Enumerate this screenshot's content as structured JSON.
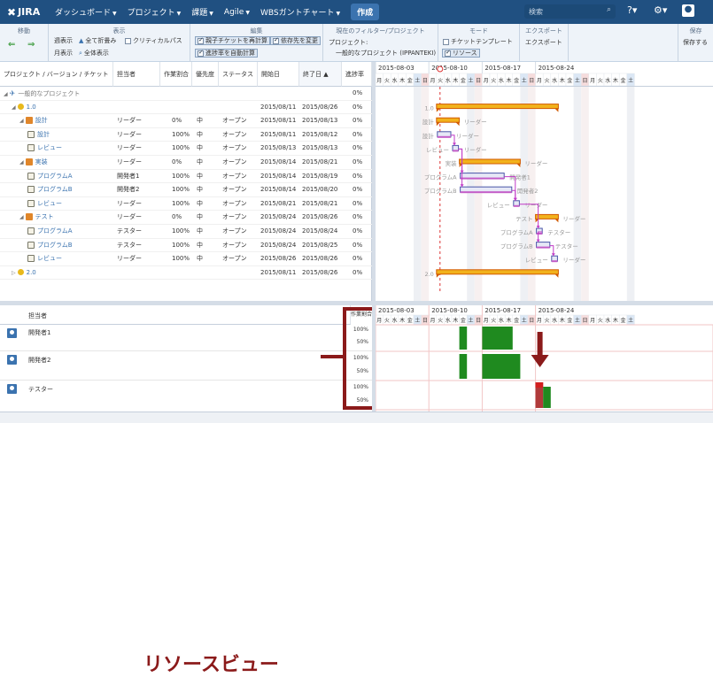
{
  "nav": {
    "logo": "JIRA",
    "items": [
      "ダッシュボード",
      "プロジェクト",
      "課題",
      "Agile",
      "WBSガントチャート"
    ],
    "create": "作成",
    "search_placeholder": "検索"
  },
  "toolbar": {
    "move": {
      "title": "移動"
    },
    "display": {
      "title": "表示",
      "weekly": "週表示",
      "collapse_all": "全て折畳み",
      "critical_path": "クリティカルパス",
      "monthly": "月表示",
      "show_all": "全体表示"
    },
    "edit": {
      "title": "編集",
      "recalc_parent": "親子チケットを再計算",
      "change_dep": "依存先を変更",
      "auto_progress": "進捗率を自動計算"
    },
    "filter": {
      "title": "現在のフィルター/プロジェクト",
      "project_label": "プロジェクト:",
      "project_value": "一般的なプロジェクト (IPPANTEKI)"
    },
    "mode": {
      "title": "モード",
      "ticket_template": "チケットテンプレート",
      "resource": "リソース"
    },
    "export": {
      "title": "エクスポート",
      "label": "エクスポート"
    },
    "save": {
      "title": "保存",
      "label": "保存する"
    }
  },
  "table": {
    "headers": [
      "プロジェクト / バージョン / チケット",
      "担当者",
      "作業割合",
      "優先度",
      "ステータス",
      "開始日",
      "終了日 ▲",
      "進捗率"
    ],
    "rows": [
      {
        "level": 0,
        "type": "proj",
        "name": "一般的なプロジェクト",
        "assignee": "",
        "ratio": "",
        "priority": "",
        "status": "",
        "start": "",
        "end": "",
        "progress": "0%"
      },
      {
        "level": 1,
        "type": "ver",
        "name": "1.0",
        "assignee": "",
        "ratio": "",
        "priority": "",
        "status": "",
        "start": "2015/08/11",
        "end": "2015/08/26",
        "progress": "0%"
      },
      {
        "level": 2,
        "type": "sum",
        "name": "設計",
        "assignee": "リーダー",
        "ratio": "0%",
        "priority": "中",
        "status": "オープン",
        "start": "2015/08/11",
        "end": "2015/08/13",
        "progress": "0%"
      },
      {
        "level": 3,
        "type": "task",
        "name": "設計",
        "assignee": "リーダー",
        "ratio": "100%",
        "priority": "中",
        "status": "オープン",
        "start": "2015/08/11",
        "end": "2015/08/12",
        "progress": "0%"
      },
      {
        "level": 3,
        "type": "task",
        "name": "レビュー",
        "assignee": "リーダー",
        "ratio": "100%",
        "priority": "中",
        "status": "オープン",
        "start": "2015/08/13",
        "end": "2015/08/13",
        "progress": "0%"
      },
      {
        "level": 2,
        "type": "sum",
        "name": "実装",
        "assignee": "リーダー",
        "ratio": "0%",
        "priority": "中",
        "status": "オープン",
        "start": "2015/08/14",
        "end": "2015/08/21",
        "progress": "0%"
      },
      {
        "level": 3,
        "type": "task",
        "name": "プログラムA",
        "assignee": "開発者1",
        "ratio": "100%",
        "priority": "中",
        "status": "オープン",
        "start": "2015/08/14",
        "end": "2015/08/19",
        "progress": "0%"
      },
      {
        "level": 3,
        "type": "task",
        "name": "プログラムB",
        "assignee": "開発者2",
        "ratio": "100%",
        "priority": "中",
        "status": "オープン",
        "start": "2015/08/14",
        "end": "2015/08/20",
        "progress": "0%"
      },
      {
        "level": 3,
        "type": "task",
        "name": "レビュー",
        "assignee": "リーダー",
        "ratio": "100%",
        "priority": "中",
        "status": "オープン",
        "start": "2015/08/21",
        "end": "2015/08/21",
        "progress": "0%"
      },
      {
        "level": 2,
        "type": "sum",
        "name": "テスト",
        "assignee": "リーダー",
        "ratio": "0%",
        "priority": "中",
        "status": "オープン",
        "start": "2015/08/24",
        "end": "2015/08/26",
        "progress": "0%"
      },
      {
        "level": 3,
        "type": "task",
        "name": "プログラムA",
        "assignee": "テスター",
        "ratio": "100%",
        "priority": "中",
        "status": "オープン",
        "start": "2015/08/24",
        "end": "2015/08/24",
        "progress": "0%"
      },
      {
        "level": 3,
        "type": "task",
        "name": "プログラムB",
        "assignee": "テスター",
        "ratio": "100%",
        "priority": "中",
        "status": "オープン",
        "start": "2015/08/24",
        "end": "2015/08/25",
        "progress": "0%"
      },
      {
        "level": 3,
        "type": "task",
        "name": "レビュー",
        "assignee": "リーダー",
        "ratio": "100%",
        "priority": "中",
        "status": "オープン",
        "start": "2015/08/26",
        "end": "2015/08/26",
        "progress": "0%"
      },
      {
        "level": 1,
        "type": "ver",
        "name": "2.0",
        "assignee": "",
        "ratio": "",
        "priority": "",
        "status": "",
        "start": "2015/08/11",
        "end": "2015/08/26",
        "progress": "0%"
      }
    ]
  },
  "gantt": {
    "weeks": [
      "2015-08-03",
      "2015-08-10",
      "2015-08-17",
      "2015-08-24"
    ],
    "days": [
      "月",
      "火",
      "水",
      "木",
      "金",
      "土",
      "日",
      "月",
      "火",
      "水",
      "木",
      "金",
      "土",
      "日",
      "月",
      "火",
      "水",
      "木",
      "金",
      "土",
      "日",
      "月",
      "火",
      "水",
      "木",
      "金",
      "土",
      "日",
      "月",
      "火",
      "水",
      "木",
      "金",
      "土"
    ],
    "bar_labels": [
      "1.0",
      "設計",
      "設計",
      "レビュー",
      "実装",
      "プログラムA",
      "プログラムB",
      "レビュー",
      "テスト",
      "プログラムA",
      "プログラムB",
      "レビュー",
      "2.0"
    ],
    "assignee_labels": [
      "リーダー",
      "リーダー",
      "リーダー",
      "リーダー",
      "開発者1",
      "開発者2",
      "リーダー",
      "リーダー",
      "テスター",
      "テスター",
      "リーダー"
    ]
  },
  "resource": {
    "header_assignee": "担当者",
    "header_ratio": "作業割合",
    "people": [
      {
        "name": "開発者1",
        "pct_top": "100%",
        "pct_bottom": "50%"
      },
      {
        "name": "開発者2",
        "pct_top": "100%",
        "pct_bottom": "50%"
      },
      {
        "name": "テスター",
        "pct_top": "100%",
        "pct_bottom": "50%"
      }
    ],
    "weeks": [
      "2015-08-03",
      "2015-08-10",
      "2015-08-17",
      "2015-08-24"
    ],
    "callout": "リソースビュー",
    "colors": {
      "green": "#1f8a1f",
      "over": "#d21f1f",
      "annotation": "#8b1a1a"
    }
  }
}
